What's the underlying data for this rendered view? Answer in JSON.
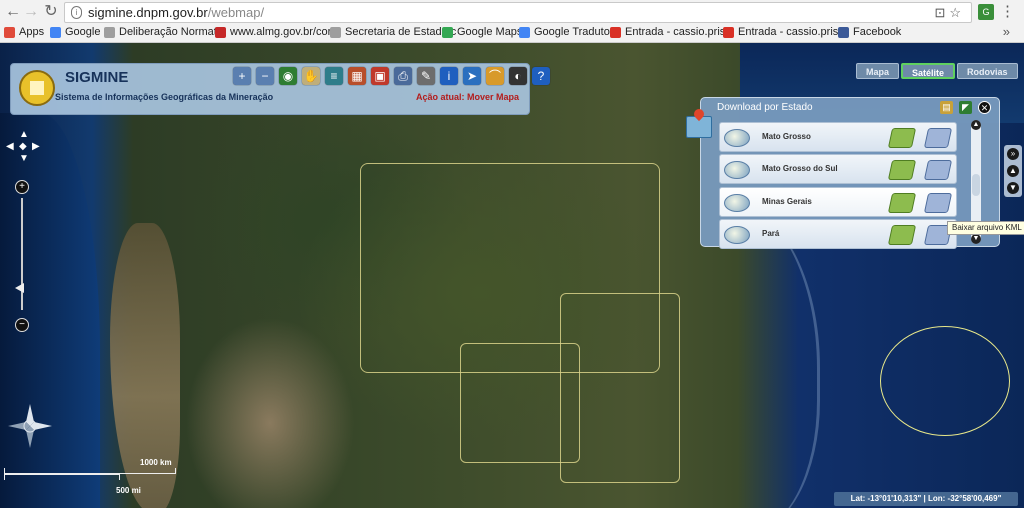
{
  "browser": {
    "url_host": "sigmine.dnpm.gov.br",
    "url_path": "/webmap/",
    "bookmarks": [
      {
        "label": "Apps",
        "icon": "apps-grid-icon",
        "color": "#e04b3b"
      },
      {
        "label": "Google",
        "icon": "google-icon",
        "color": "#4285f4"
      },
      {
        "label": "Deliberação Normativ",
        "icon": "page-icon",
        "color": "#9e9e9e"
      },
      {
        "label": "www.almg.gov.br/cor",
        "icon": "almg-icon",
        "color": "#c62828"
      },
      {
        "label": "Secretaria de Estado c",
        "icon": "page-icon",
        "color": "#9e9e9e"
      },
      {
        "label": "Google Maps",
        "icon": "maps-icon",
        "color": "#34a853"
      },
      {
        "label": "Google Tradutor",
        "icon": "translate-icon",
        "color": "#4285f4"
      },
      {
        "label": "Entrada - cassio.prist",
        "icon": "gmail-icon",
        "color": "#d93025"
      },
      {
        "label": "Entrada - cassio.prist",
        "icon": "gmail-icon",
        "color": "#d93025"
      },
      {
        "label": "Facebook",
        "icon": "facebook-icon",
        "color": "#3b5998"
      }
    ],
    "more": "»"
  },
  "app": {
    "name": "SIGMINE",
    "subtitle": "Sistema de Informações Geográficas da Mineração",
    "action": "Ação atual: Mover Mapa",
    "tools": [
      {
        "icon": "zoom-in-icon",
        "color": "#5a7fb0",
        "glyph": "+"
      },
      {
        "icon": "zoom-out-icon",
        "color": "#5a7fb0",
        "glyph": "−"
      },
      {
        "icon": "globe-icon",
        "color": "#2e7d32",
        "glyph": "◉"
      },
      {
        "icon": "hand-pan-icon",
        "color": "#bfae7a",
        "glyph": "✋"
      },
      {
        "icon": "layers-icon",
        "color": "#2e7d8a",
        "glyph": "≡"
      },
      {
        "icon": "map-layers-icon",
        "color": "#b84e2a",
        "glyph": "▦"
      },
      {
        "icon": "layer-select-icon",
        "color": "#c0392b",
        "glyph": "▣"
      },
      {
        "icon": "print-icon",
        "color": "#4a6a9a",
        "glyph": "⎙"
      },
      {
        "icon": "draw-pencil-icon",
        "color": "#6d6d6d",
        "glyph": "✎"
      },
      {
        "icon": "info-icon",
        "color": "#1f5fbf",
        "glyph": "i"
      },
      {
        "icon": "pin-icon",
        "color": "#2a6fbf",
        "glyph": "➤"
      },
      {
        "icon": "measure-icon",
        "color": "#d89a2a",
        "glyph": "⌒"
      },
      {
        "icon": "fullscreen-icon",
        "color": "#333333",
        "glyph": "◐"
      },
      {
        "icon": "help-icon",
        "color": "#1f5fbf",
        "glyph": "?"
      }
    ]
  },
  "map_type": {
    "buttons": [
      "Mapa",
      "Satélite",
      "Rodovias"
    ],
    "active": "Satélite"
  },
  "download": {
    "title": "Download por Estado",
    "rows": [
      {
        "name": "Mato Grosso"
      },
      {
        "name": "Mato Grosso do Sul"
      },
      {
        "name": "Minas Gerais"
      },
      {
        "name": "Pará"
      }
    ],
    "tooltip": "Baixar arquivo KML"
  },
  "scale": {
    "km": "1000 km",
    "mi": "500 mi"
  },
  "coordinates": "Lat: -13°01'10,313\" | Lon: -32°58'00,469\""
}
